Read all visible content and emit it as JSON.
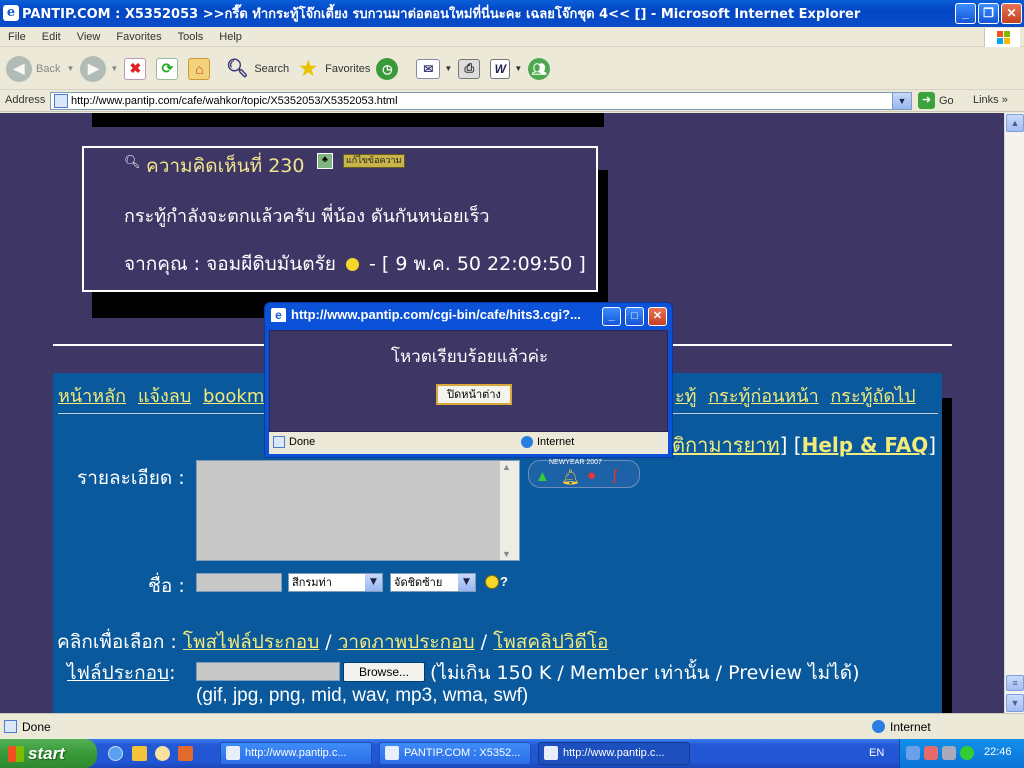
{
  "window": {
    "title": "PANTIP.COM : X5352053 >>กรี๊ด ทำกระทู้โจ๊กเตี้ยง รบกวนมาต่อตอนใหม่ที่นี่นะคะ เฉลยโจ๊กชุด 4<< [] - Microsoft Internet Explorer"
  },
  "menu": [
    "File",
    "Edit",
    "View",
    "Favorites",
    "Tools",
    "Help"
  ],
  "toolbar": {
    "back": "Back",
    "search": "Search",
    "favorites": "Favorites"
  },
  "address": {
    "label": "Address",
    "url": "http://www.pantip.com/cafe/wahkor/topic/X5352053/X5352053.html",
    "go": "Go",
    "links": "Links"
  },
  "comment": {
    "title": "ความคิดเห็นที่ 230",
    "edit_label": "แก้ไขข้อความ",
    "body": "กระทู้กำลังจะตกแล้วครับ พี่น้อง ดันกันหน่อยเร็ว",
    "author": "จากคุณ : จอมผีดิบมันตรัย",
    "timestamp": "- [ 9 พ.ค. 50 22:09:50 ]"
  },
  "nav": {
    "left": [
      "หน้าหลัก",
      "แจ้งลบ",
      "bookm"
    ],
    "right": [
      "ะทู้",
      "กระทู้ก่อนหน้า",
      "กระทู้ถัดไป"
    ]
  },
  "help": {
    "etiquette": "ติกามารยาท",
    "faq": "Help & FAQ"
  },
  "form": {
    "detail_label": "รายละเอียด :",
    "name_label": "ชื่อ :",
    "color_select": "สีกรมท่า",
    "align_select": "จัดชิดซ้าย",
    "smiley_q": "?",
    "click_label": "คลิกเพื่อเลือก :",
    "post_file": "โพสไฟล์ประกอบ",
    "draw_image": "วาดภาพประกอบ",
    "post_video": "โพสคลิปวิดีโอ",
    "file_label": "ไฟล์ประกอบ",
    "file_colon": " :",
    "browse": "Browse...",
    "file_note": "(ไม่เกิน 150 K / Member เท่านั้น / Preview ไม่ได้)",
    "file_types": "(gif, jpg, png, mid, wav, mp3, wma, swf)",
    "emoticon_caption": "NEWYEAR 2007"
  },
  "popup": {
    "title": "http://www.pantip.com/cgi-bin/cafe/hits3.cgi?...",
    "message": "โหวตเรียบร้อยแล้วค่ะ",
    "close_label": "ปิดหน้าต่าง",
    "status": "Done",
    "zone": "Internet"
  },
  "status": {
    "text": "Done",
    "zone": "Internet"
  },
  "taskbar": {
    "start": "start",
    "tasks": [
      "http://www.pantip.c...",
      "PANTIP.COM : X5352...",
      "http://www.pantip.c..."
    ],
    "lang": "EN",
    "clock": "22:46"
  },
  "colors": {
    "page_bg": "#3e3766",
    "panel_bg": "#09599c",
    "link_yellow": "#f2ea7a",
    "title_blue": "#0a5fd8"
  }
}
